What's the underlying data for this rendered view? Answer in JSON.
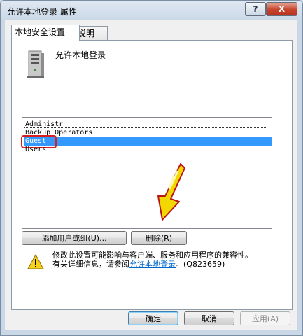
{
  "window": {
    "title": "允许本地登录 属性",
    "help_label": "?",
    "close_label": "X"
  },
  "tabs": [
    {
      "label": "本地安全设置",
      "active": true
    },
    {
      "label": "说明",
      "active": false
    }
  ],
  "policy": {
    "icon": "server-icon",
    "name": "允许本地登录"
  },
  "user_list": {
    "items": [
      "Administr",
      "Backup Operators",
      "Guest",
      "Users"
    ],
    "selected_index": 2,
    "highlight_color": "#d81e1e",
    "selection_color": "#3399ff"
  },
  "annotation": {
    "arrow_icon": "yellow-arrow-icon",
    "arrow_color": "#f2d800"
  },
  "buttons": {
    "add_user": "添加用户或组(U)...",
    "remove": "删除(R)",
    "ok": "确定",
    "cancel": "取消",
    "apply": "应用(A)"
  },
  "warning": {
    "icon": "warning-icon",
    "line1": "修改此设置可能影响与客户端、服务和应用程序的兼容性。",
    "line2_prefix": "有关详细信息，请参阅",
    "link": "允许本地登录",
    "line2_suffix": "。(Q823659)"
  }
}
